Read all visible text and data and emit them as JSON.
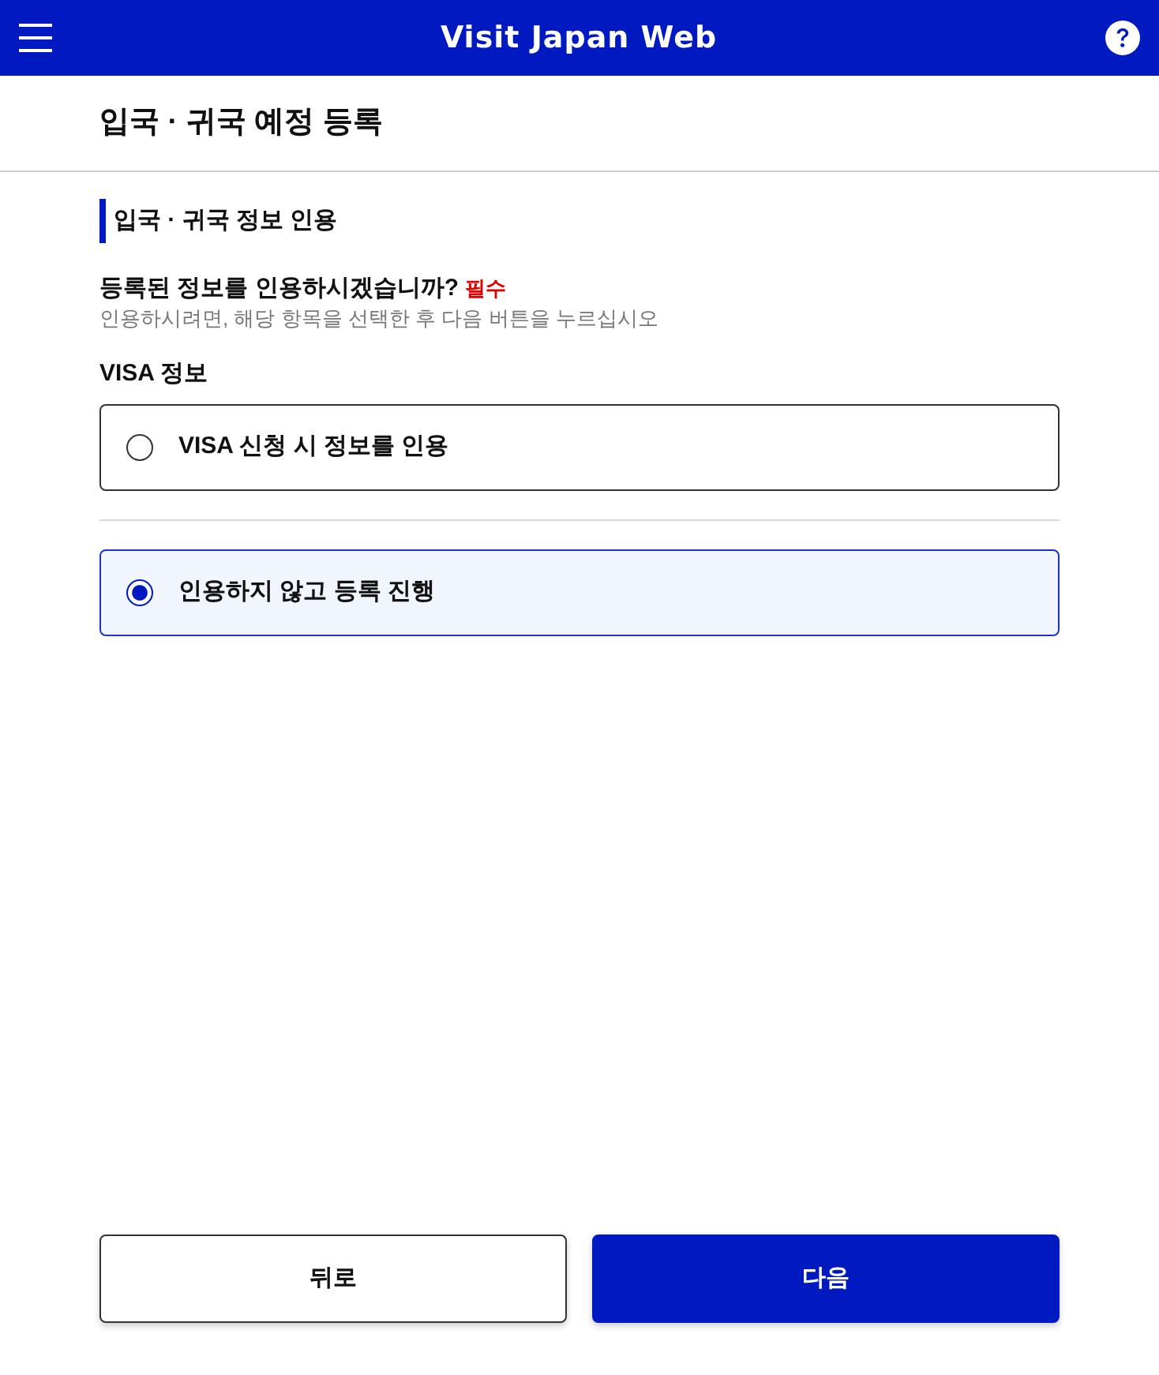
{
  "header": {
    "title": "Visit Japan Web"
  },
  "page_title": "입국 · 귀국 예정 등록",
  "section": {
    "heading": "입국 · 귀국 정보 인용",
    "question": "등록된 정보를 인용하시겠습니까?",
    "required_badge": "필수",
    "hint": "인용하시려면, 해당 항목을 선택한 후 다음 버튼을 누르십시오",
    "group_label": "VISA 정보",
    "options": [
      {
        "label": "VISA 신청 시 정보를 인용",
        "selected": false
      },
      {
        "label": "인용하지 않고 등록 진행",
        "selected": true
      }
    ]
  },
  "buttons": [
    {
      "label": "뒤로",
      "kind": "secondary"
    },
    {
      "label": "다음",
      "kind": "primary"
    }
  ]
}
